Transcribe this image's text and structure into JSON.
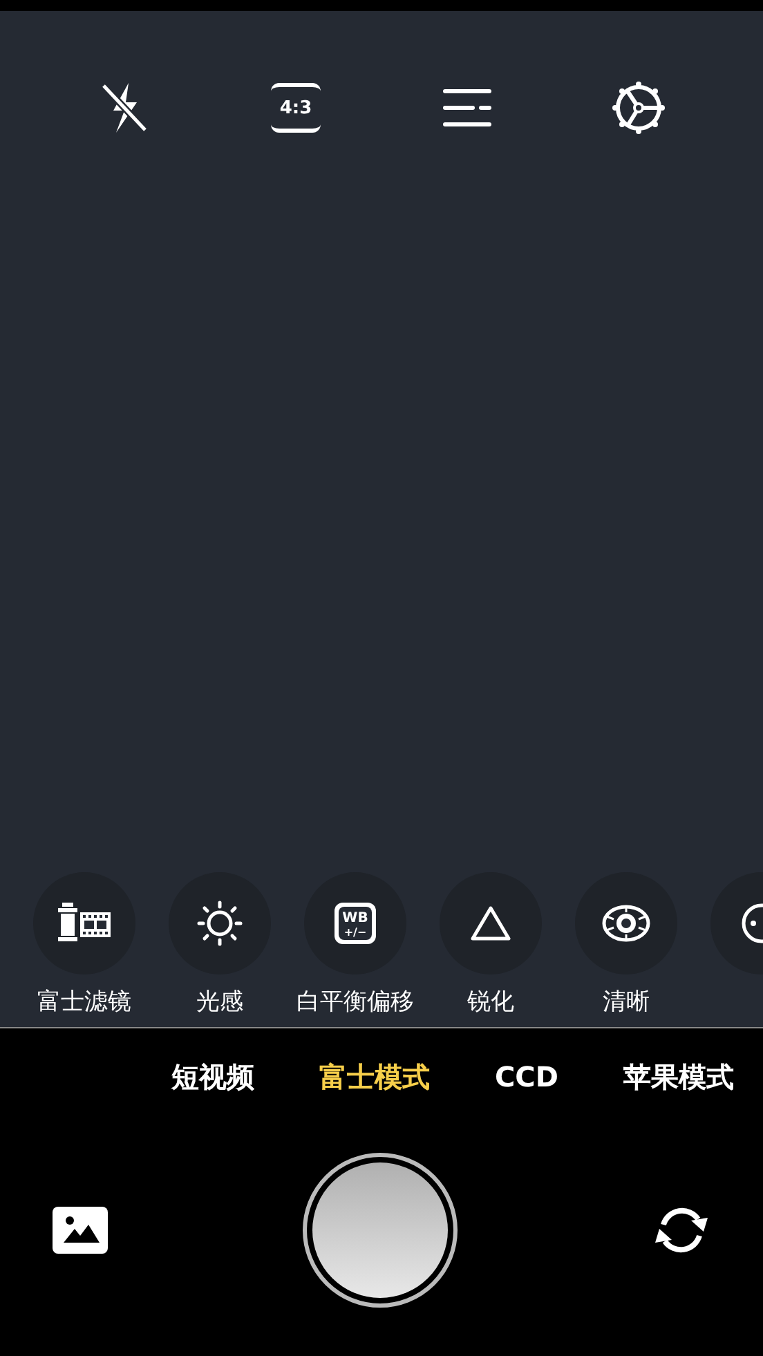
{
  "toolbar": [
    {
      "kind": "flash_off"
    },
    {
      "kind": "ratio",
      "label": "4:3"
    },
    {
      "kind": "menu"
    },
    {
      "kind": "settings"
    }
  ],
  "tools": [
    {
      "kind": "film",
      "label": "富士滤镜"
    },
    {
      "kind": "sun",
      "label": "光感"
    },
    {
      "kind": "wb",
      "icon_text": [
        "WB",
        "+/−"
      ],
      "label": "白平衡偏移"
    },
    {
      "kind": "triangle",
      "label": "锐化"
    },
    {
      "kind": "eye",
      "label": "清晰"
    },
    {
      "kind": "ring"
    }
  ],
  "modes": [
    {
      "label": "短视频",
      "selected": false
    },
    {
      "label": "富士模式",
      "selected": true
    },
    {
      "label": "CCD",
      "selected": false
    },
    {
      "label": "苹果模式",
      "selected": false
    }
  ]
}
